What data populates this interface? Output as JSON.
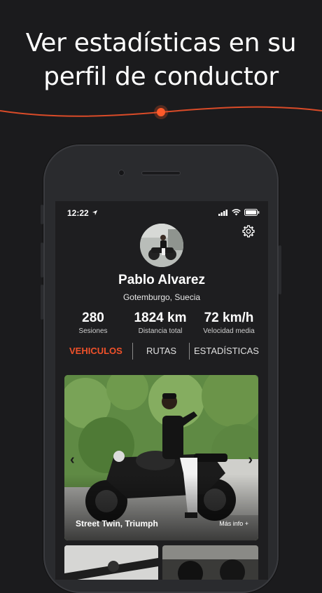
{
  "headline": {
    "line1": "Ver estadísticas en su",
    "line2": "perfil de conductor"
  },
  "colors": {
    "accent": "#f0512a",
    "background": "#1b1b1d"
  },
  "status_bar": {
    "time": "12:22"
  },
  "profile": {
    "name": "Pablo Alvarez",
    "location": "Gotemburgo, Suecia"
  },
  "stats": [
    {
      "value": "280",
      "label": "Sesiones"
    },
    {
      "value": "1824 km",
      "label": "Distancia total"
    },
    {
      "value": "72 km/h",
      "label": "Velocidad media"
    }
  ],
  "tabs": [
    {
      "label": "VEHICULOS",
      "active": true
    },
    {
      "label": "RUTAS",
      "active": false
    },
    {
      "label": "ESTADÍSTICAS",
      "active": false
    }
  ],
  "vehicle_card": {
    "title": "Street Twin, Triumph",
    "more": "Más info +"
  },
  "icons": [
    "location-arrow-icon",
    "signal-icon",
    "wifi-icon",
    "battery-icon",
    "gear-icon",
    "chevron-left-icon",
    "chevron-right-icon"
  ]
}
